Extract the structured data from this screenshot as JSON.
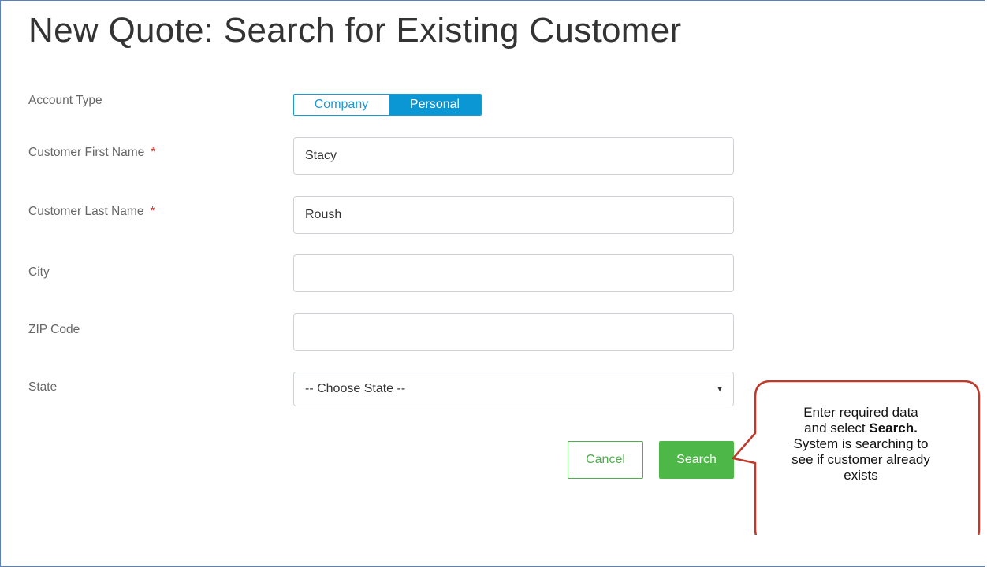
{
  "page": {
    "title": "New Quote: Search for Existing Customer"
  },
  "form": {
    "account_type": {
      "label": "Account Type",
      "options": [
        "Company",
        "Personal"
      ],
      "selected": "Personal"
    },
    "first_name": {
      "label": "Customer First Name",
      "required_mark": "*",
      "value": "Stacy"
    },
    "last_name": {
      "label": "Customer Last Name",
      "required_mark": "*",
      "value": "Roush"
    },
    "city": {
      "label": "City",
      "value": ""
    },
    "zip": {
      "label": "ZIP Code",
      "value": ""
    },
    "state": {
      "label": "State",
      "selected": "-- Choose State --",
      "caret": "▼"
    }
  },
  "actions": {
    "cancel_label": "Cancel",
    "search_label": "Search"
  },
  "callout": {
    "line1": "Enter required data",
    "line2_prefix": "and select ",
    "line2_bold": "Search.",
    "line3": "System is searching to",
    "line4": "see if customer already",
    "line5": "exists"
  },
  "colors": {
    "accent_blue": "#0a97d4",
    "search_green": "#4db848",
    "required_red": "#e0382f",
    "callout_border": "#c0392b"
  }
}
